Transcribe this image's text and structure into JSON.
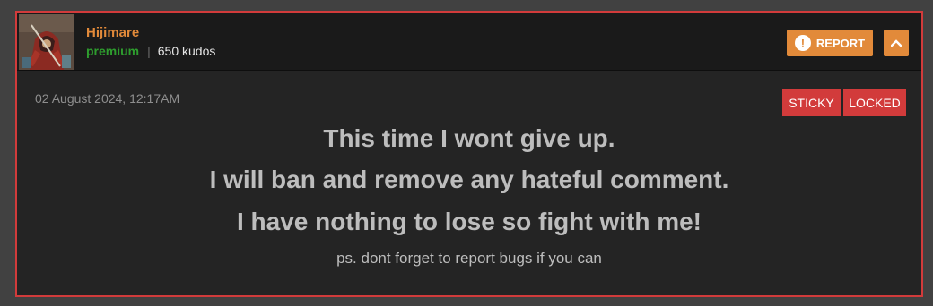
{
  "post": {
    "author": {
      "name": "Hijimare",
      "rank": "premium",
      "separator": "|",
      "kudos": "650 kudos"
    },
    "actions": {
      "report_label": "REPORT",
      "report_icon": "exclamation-circle-icon",
      "collapse_icon": "chevron-up-icon"
    },
    "date": "02 August 2024, 12:17AM",
    "tags": [
      "STICKY",
      "LOCKED"
    ],
    "body": {
      "lines": [
        "This time I wont give up.",
        "I will ban and remove any hateful comment.",
        "I have nothing to lose so fight with me!"
      ],
      "ps": "ps. dont forget to report bugs if you can"
    }
  },
  "colors": {
    "page_bg": "#414141",
    "post_border": "#d23b3b",
    "header_bg": "#1a1a1a",
    "body_bg": "#242424",
    "accent_orange": "#e28a3a",
    "rank_green": "#2e9d2e",
    "tag_red": "#d23b3b",
    "body_text": "#bdbdbd",
    "date_text": "#8e8e8e"
  }
}
